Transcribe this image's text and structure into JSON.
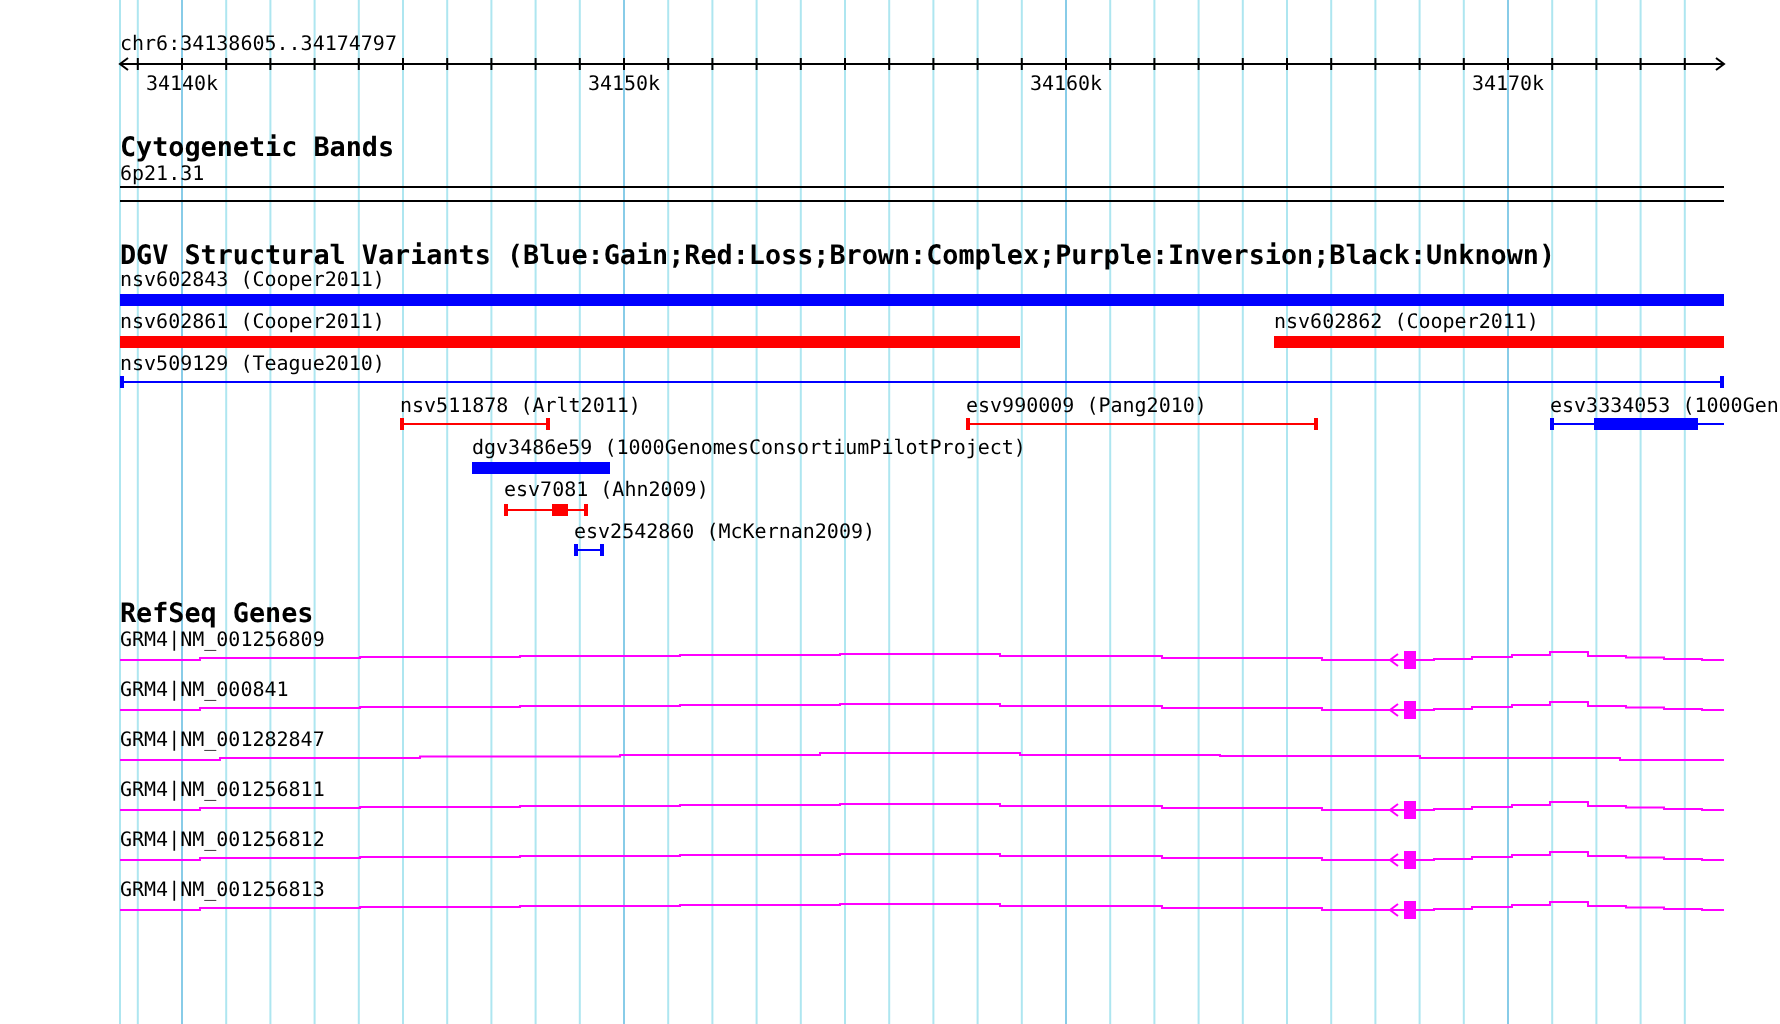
{
  "location": "chr6:34138605..34174797",
  "ruler": {
    "labels": [
      "34140k",
      "34150k",
      "34160k",
      "34170k"
    ]
  },
  "cytogenetic_bands": {
    "title": "Cytogenetic Bands",
    "band": "6p21.31"
  },
  "dgv_variants": {
    "title": "DGV Structural Variants (Blue:Gain;Red:Loss;Brown:Complex;Purple:Inversion;Black:Unknown)",
    "features": [
      {
        "label": "nsv602843 (Cooper2011)",
        "kind": "bar",
        "color": "#0000ff"
      },
      {
        "label": "nsv602861 (Cooper2011)",
        "kind": "bar",
        "color": "#ff0000"
      },
      {
        "label": "nsv602862 (Cooper2011)",
        "kind": "bar",
        "color": "#ff0000"
      },
      {
        "label": "nsv509129 (Teague2010)",
        "kind": "span",
        "color": "#0000ff"
      },
      {
        "label": "nsv511878 (Arlt2011)",
        "kind": "span",
        "color": "#ff0000"
      },
      {
        "label": "esv990009 (Pang2010)",
        "kind": "span",
        "color": "#ff0000"
      },
      {
        "label": "esv3334053 (1000Gen",
        "kind": "span_block",
        "color": "#0000ff"
      },
      {
        "label": "dgv3486e59 (1000GenomesConsortiumPilotProject)",
        "kind": "bar",
        "color": "#0000ff"
      },
      {
        "label": "esv7081 (Ahn2009)",
        "kind": "span_block",
        "color": "#ff0000"
      },
      {
        "label": "esv2542860 (McKernan2009)",
        "kind": "span",
        "color": "#0000ff"
      }
    ]
  },
  "refseq_genes": {
    "title": "RefSeq Genes",
    "transcripts": [
      {
        "label": "GRM4|NM_001256809",
        "kind": "with_exon"
      },
      {
        "label": "GRM4|NM_000841",
        "kind": "with_exon"
      },
      {
        "label": "GRM4|NM_001282847",
        "kind": "intron_only"
      },
      {
        "label": "GRM4|NM_001256811",
        "kind": "with_exon"
      },
      {
        "label": "GRM4|NM_001256812",
        "kind": "with_exon"
      },
      {
        "label": "GRM4|NM_001256813",
        "kind": "with_exon"
      }
    ]
  }
}
